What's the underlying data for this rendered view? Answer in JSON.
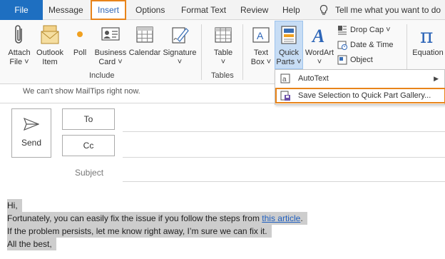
{
  "tabs": {
    "file": "File",
    "message": "Message",
    "insert": "Insert",
    "options": "Options",
    "format_text": "Format Text",
    "review": "Review",
    "help": "Help",
    "tell_me": "Tell me what you want to do"
  },
  "ribbon": {
    "include": {
      "attach_file": [
        "Attach",
        "File ˅"
      ],
      "outlook_item": [
        "Outlook",
        "Item"
      ],
      "poll": "Poll",
      "business_card": [
        "Business",
        "Card ˅"
      ],
      "calendar": "Calendar",
      "signature": [
        "Signature",
        "˅"
      ],
      "group_label": "Include"
    },
    "tables": {
      "table": [
        "Table",
        "˅"
      ],
      "group_label": "Tables"
    },
    "text": {
      "text_box": [
        "Text",
        "Box ˅"
      ],
      "quick_parts": [
        "Quick",
        "Parts ˅"
      ],
      "wordart": [
        "WordArt",
        "˅"
      ],
      "drop_cap": "Drop Cap ˅",
      "date_time": "Date & Time",
      "object": "Object"
    },
    "symbols": {
      "equation": "Equation"
    }
  },
  "quick_parts_menu": {
    "items": [
      "AutoText",
      "Save Selection to Quick Part Gallery..."
    ]
  },
  "compose": {
    "mailtips": "We can't show MailTips right now.",
    "send": "Send",
    "to": "To",
    "cc": "Cc",
    "subject_label": "Subject",
    "body": {
      "greeting": "Hi,",
      "line1_prefix": "Fortunately, you can easily fix the issue if you follow the steps from ",
      "line1_link": "this article",
      "line1_suffix": ".",
      "line2": "If the problem persists, let me know right away, I’m sure we can fix it.",
      "closing": "All the best,"
    }
  },
  "colors": {
    "file_tab": "#1e6fc1",
    "highlight_outline": "#e8841a",
    "active_button": "#c7ddf5",
    "selection": "#cdcdcd",
    "link": "#1f5fbf"
  }
}
